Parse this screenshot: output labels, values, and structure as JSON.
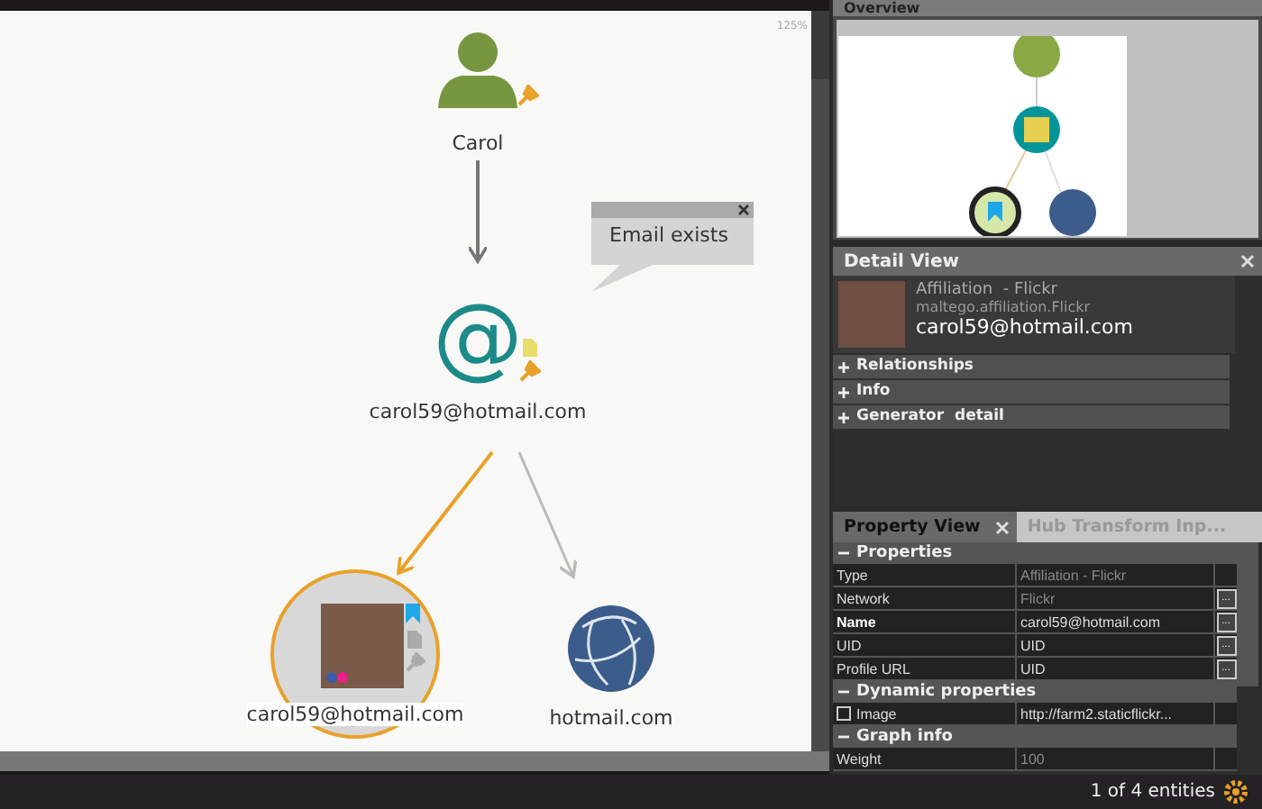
{
  "graph": {
    "zoom": "125%",
    "nodes": [
      {
        "kind": "person",
        "label": "Carol",
        "pinned": true,
        "has_note": false,
        "bookmarked": false,
        "selected": false
      },
      {
        "kind": "email",
        "icon_char": "@",
        "label": "carol59@hotmail.com",
        "pinned": true,
        "has_note": true,
        "bookmarked": false,
        "selected": false
      },
      {
        "kind": "affiliation",
        "label": "carol59@hotmail.com",
        "pinned": false,
        "has_note": false,
        "bookmarked": true,
        "selected": true
      },
      {
        "kind": "domain",
        "label": "hotmail.com",
        "pinned": false,
        "has_note": false,
        "bookmarked": false,
        "selected": false
      }
    ],
    "note": {
      "text": "Email exists"
    }
  },
  "overview": {
    "title": "Overview"
  },
  "detail_view": {
    "title": "Detail View",
    "type": "Affiliation  - Flickr",
    "type_id": "maltego.affiliation.Flickr",
    "value": "carol59@hotmail.com",
    "sections": [
      {
        "label": "Relationships",
        "expanded": false
      },
      {
        "label": "Info",
        "expanded": false
      },
      {
        "label": "Generator  detail",
        "expanded": false
      }
    ]
  },
  "property_view": {
    "tabs": [
      {
        "label": "Property View",
        "selected": true
      },
      {
        "label": "Hub Transform Inp...",
        "selected": false
      }
    ],
    "groups": [
      {
        "title": "Properties",
        "expanded": true,
        "rows": [
          {
            "name": "Type",
            "value": "Affiliation - Flickr",
            "readonly": true,
            "bold": false,
            "has_button": false
          },
          {
            "name": "Network",
            "value": "Flickr",
            "readonly": true,
            "bold": false,
            "has_button": true,
            "button_label": "..."
          },
          {
            "name": "Name",
            "value": "carol59@hotmail.com",
            "readonly": false,
            "bold": true,
            "has_button": true,
            "button_label": "..."
          },
          {
            "name": "UID",
            "value": "UID",
            "readonly": false,
            "bold": false,
            "has_button": true,
            "button_label": "..."
          },
          {
            "name": "Profile URL",
            "value": "UID",
            "readonly": false,
            "bold": false,
            "has_button": true,
            "button_label": "..."
          }
        ]
      },
      {
        "title": "Dynamic properties",
        "expanded": true,
        "rows": [
          {
            "name": "Image",
            "value": "http://farm2.staticflickr...",
            "readonly": false,
            "bold": false,
            "has_button": false,
            "checked": false
          }
        ]
      },
      {
        "title": "Graph info",
        "expanded": true,
        "rows": [
          {
            "name": "Weight",
            "value": "100",
            "readonly": true,
            "bold": false,
            "has_button": false
          }
        ]
      }
    ]
  },
  "status_bar": {
    "text": "1 of 4 entities"
  }
}
